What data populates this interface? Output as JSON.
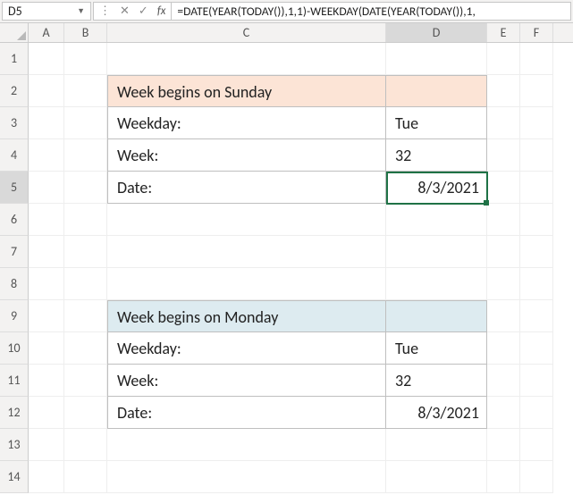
{
  "namebox": {
    "value": "D5",
    "dropdown": "▼"
  },
  "fxbar": {
    "dots": "⋮",
    "cancel": "✕",
    "commit": "✓",
    "fx": "fx",
    "formula": "=DATE(YEAR(TODAY()),1,1)-WEEKDAY(DATE(YEAR(TODAY()),1,"
  },
  "cols": {
    "A": "A",
    "B": "B",
    "C": "C",
    "D": "D",
    "E": "E",
    "F": "F"
  },
  "rows": {
    "r1": "1",
    "r2": "2",
    "r3": "3",
    "r4": "4",
    "r5": "5",
    "r6": "6",
    "r7": "7",
    "r8": "8",
    "r9": "9",
    "r10": "10",
    "r11": "11",
    "r12": "12",
    "r13": "13",
    "r14": "14"
  },
  "table1": {
    "title": "Week begins on Sunday",
    "rows": [
      {
        "label": "Weekday:",
        "value": "Tue"
      },
      {
        "label": "Week:",
        "value": "32"
      },
      {
        "label": "Date:",
        "value": "8/3/2021"
      }
    ]
  },
  "table2": {
    "title": "Week begins on Monday",
    "rows": [
      {
        "label": "Weekday:",
        "value": "Tue"
      },
      {
        "label": "Week:",
        "value": "32"
      },
      {
        "label": "Date:",
        "value": "8/3/2021"
      }
    ]
  },
  "selection": {
    "cell": "D5"
  }
}
